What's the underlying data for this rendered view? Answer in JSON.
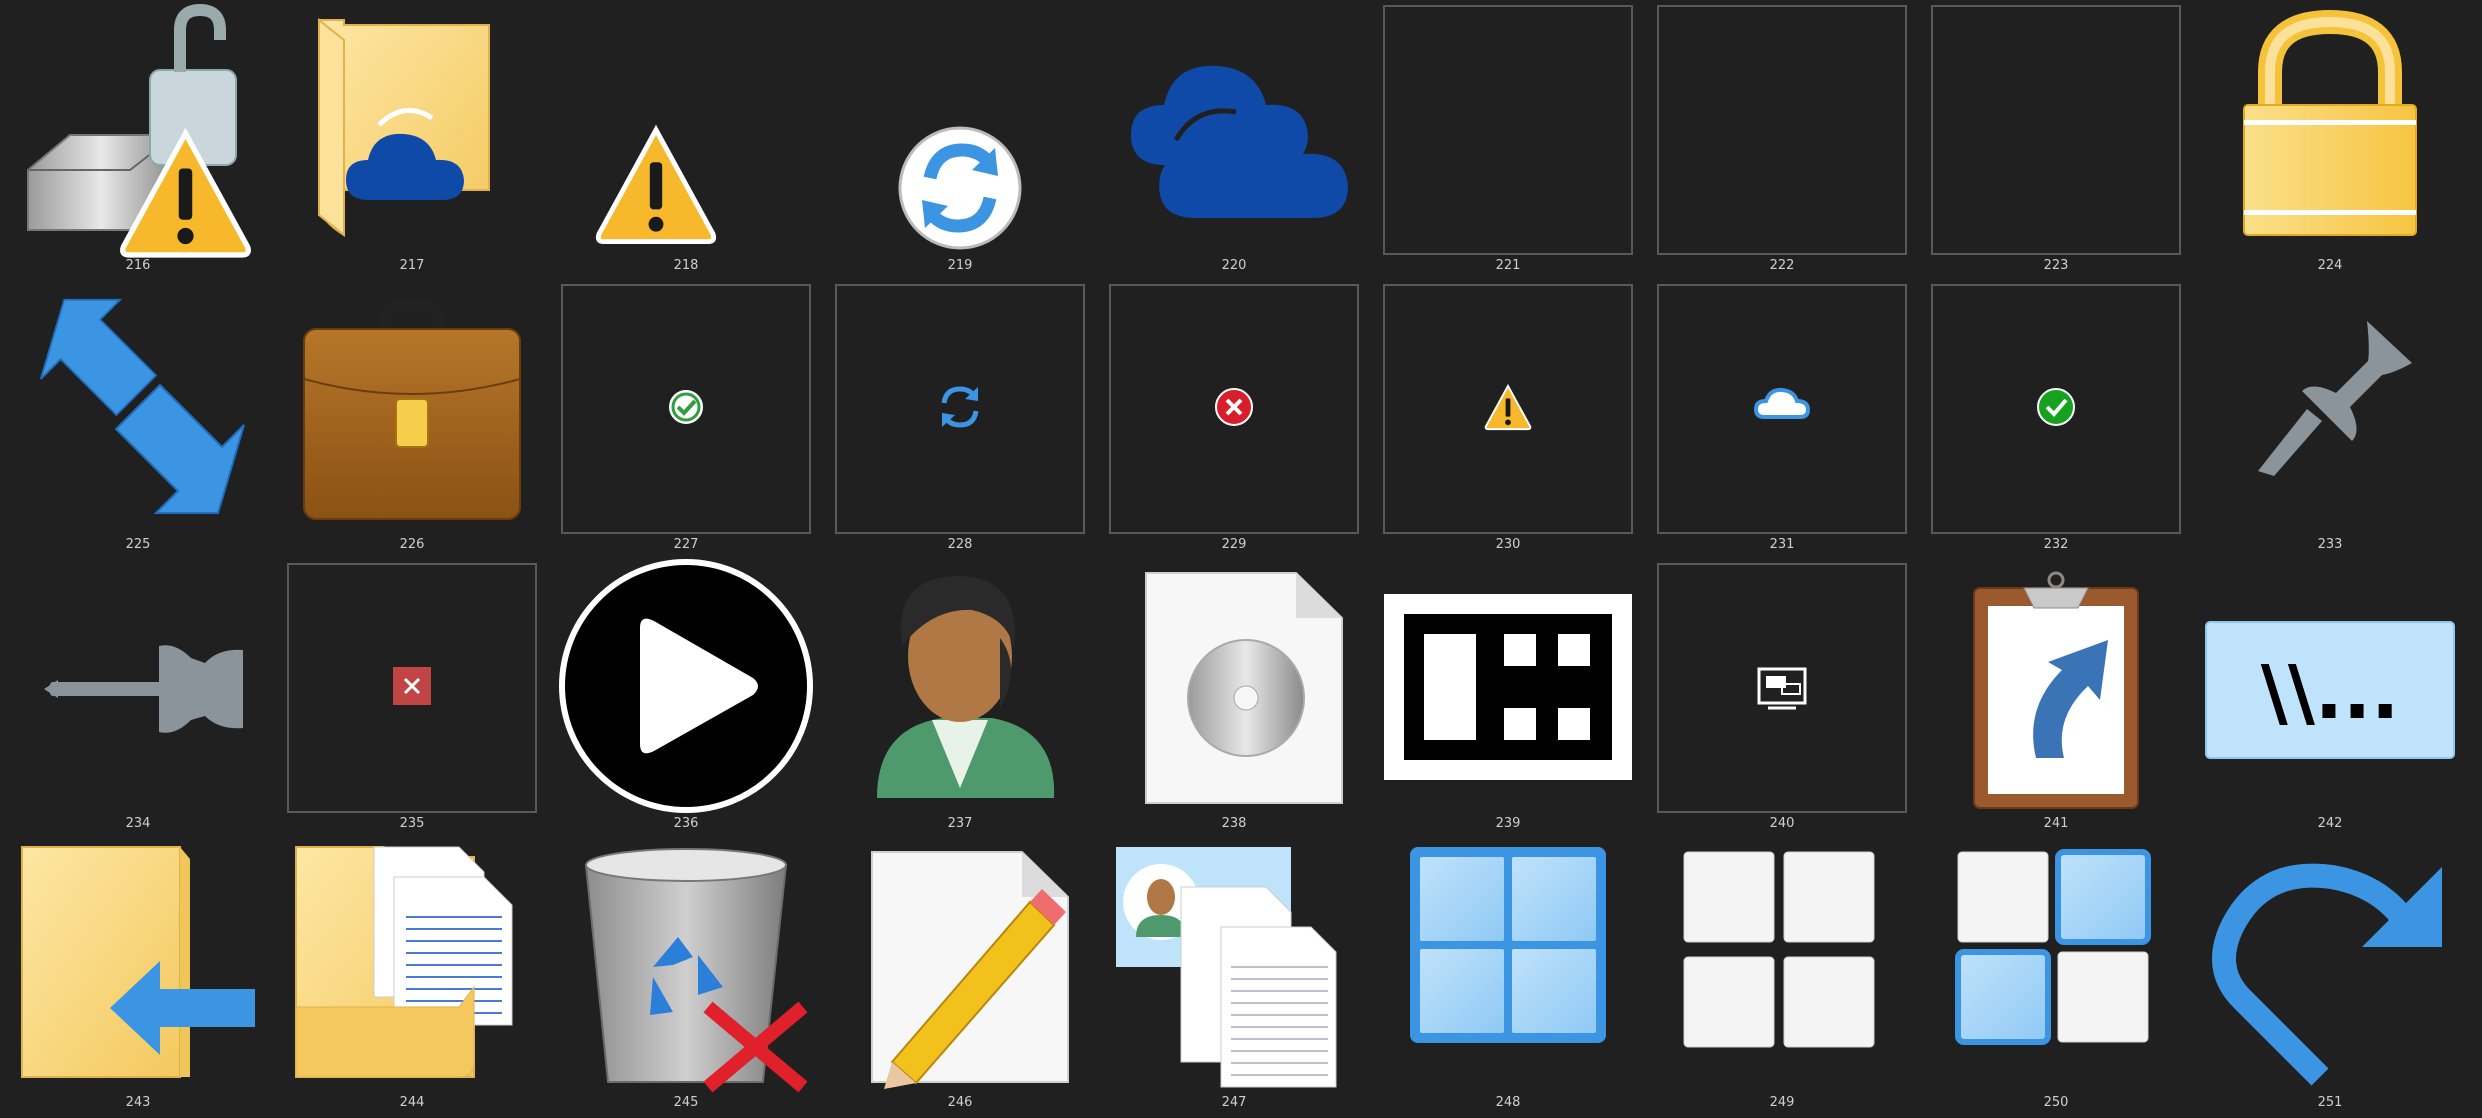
{
  "window": {
    "background": "#202020"
  },
  "icon_grid": {
    "columns": 9,
    "rows": 4,
    "items": [
      {
        "id": "216",
        "name": "unlocked-drive-warning-icon",
        "boxed": false
      },
      {
        "id": "217",
        "name": "onedrive-folder-icon",
        "boxed": false
      },
      {
        "id": "218",
        "name": "warning-triangle-icon",
        "boxed": false
      },
      {
        "id": "219",
        "name": "sync-circle-icon",
        "boxed": false
      },
      {
        "id": "220",
        "name": "onedrive-cloud-icon",
        "boxed": false
      },
      {
        "id": "221",
        "name": "blank-overlay-icon",
        "boxed": true
      },
      {
        "id": "222",
        "name": "blank-overlay-icon",
        "boxed": true
      },
      {
        "id": "223",
        "name": "blank-overlay-icon",
        "boxed": true
      },
      {
        "id": "224",
        "name": "padlock-icon",
        "boxed": false
      },
      {
        "id": "225",
        "name": "compress-arrows-icon",
        "boxed": false
      },
      {
        "id": "226",
        "name": "briefcase-icon",
        "boxed": false
      },
      {
        "id": "227",
        "name": "check-overlay-icon",
        "boxed": true
      },
      {
        "id": "228",
        "name": "sync-overlay-icon",
        "boxed": true
      },
      {
        "id": "229",
        "name": "error-overlay-icon",
        "boxed": true
      },
      {
        "id": "230",
        "name": "warning-overlay-icon",
        "boxed": true
      },
      {
        "id": "231",
        "name": "cloud-overlay-icon",
        "boxed": true
      },
      {
        "id": "232",
        "name": "green-check-overlay-icon",
        "boxed": true
      },
      {
        "id": "233",
        "name": "pin-icon",
        "boxed": false
      },
      {
        "id": "234",
        "name": "unpin-icon",
        "boxed": false
      },
      {
        "id": "235",
        "name": "red-x-overlay-icon",
        "boxed": true
      },
      {
        "id": "236",
        "name": "play-circle-icon",
        "boxed": false
      },
      {
        "id": "237",
        "name": "user-avatar-icon",
        "boxed": false
      },
      {
        "id": "238",
        "name": "disc-image-file-icon",
        "boxed": false
      },
      {
        "id": "239",
        "name": "tile-layout-icon",
        "boxed": false
      },
      {
        "id": "240",
        "name": "remote-desktop-overlay-icon",
        "boxed": true
      },
      {
        "id": "241",
        "name": "clipboard-shortcut-icon",
        "boxed": false
      },
      {
        "id": "242",
        "name": "network-path-icon",
        "boxed": false
      },
      {
        "id": "243",
        "name": "folder-back-arrow-icon",
        "boxed": false
      },
      {
        "id": "244",
        "name": "folder-documents-icon",
        "boxed": false
      },
      {
        "id": "245",
        "name": "recycle-bin-delete-icon",
        "boxed": false
      },
      {
        "id": "246",
        "name": "document-edit-icon",
        "boxed": false
      },
      {
        "id": "247",
        "name": "contact-documents-icon",
        "boxed": false
      },
      {
        "id": "248",
        "name": "start-tiles-blue-icon",
        "boxed": false
      },
      {
        "id": "249",
        "name": "start-tiles-white-icon",
        "boxed": false
      },
      {
        "id": "250",
        "name": "start-tiles-mixed-icon",
        "boxed": false
      },
      {
        "id": "251",
        "name": "redo-arrow-icon",
        "boxed": false
      }
    ]
  },
  "icon_texts": {
    "network_path": "\\\\..."
  },
  "colors": {
    "blue": "#3b95e3",
    "folder": "#f9d77e",
    "warning": "#f7b92b",
    "onedrive": "#0f4aa8",
    "label": "#cfcfcf",
    "box_border": "#595959"
  }
}
